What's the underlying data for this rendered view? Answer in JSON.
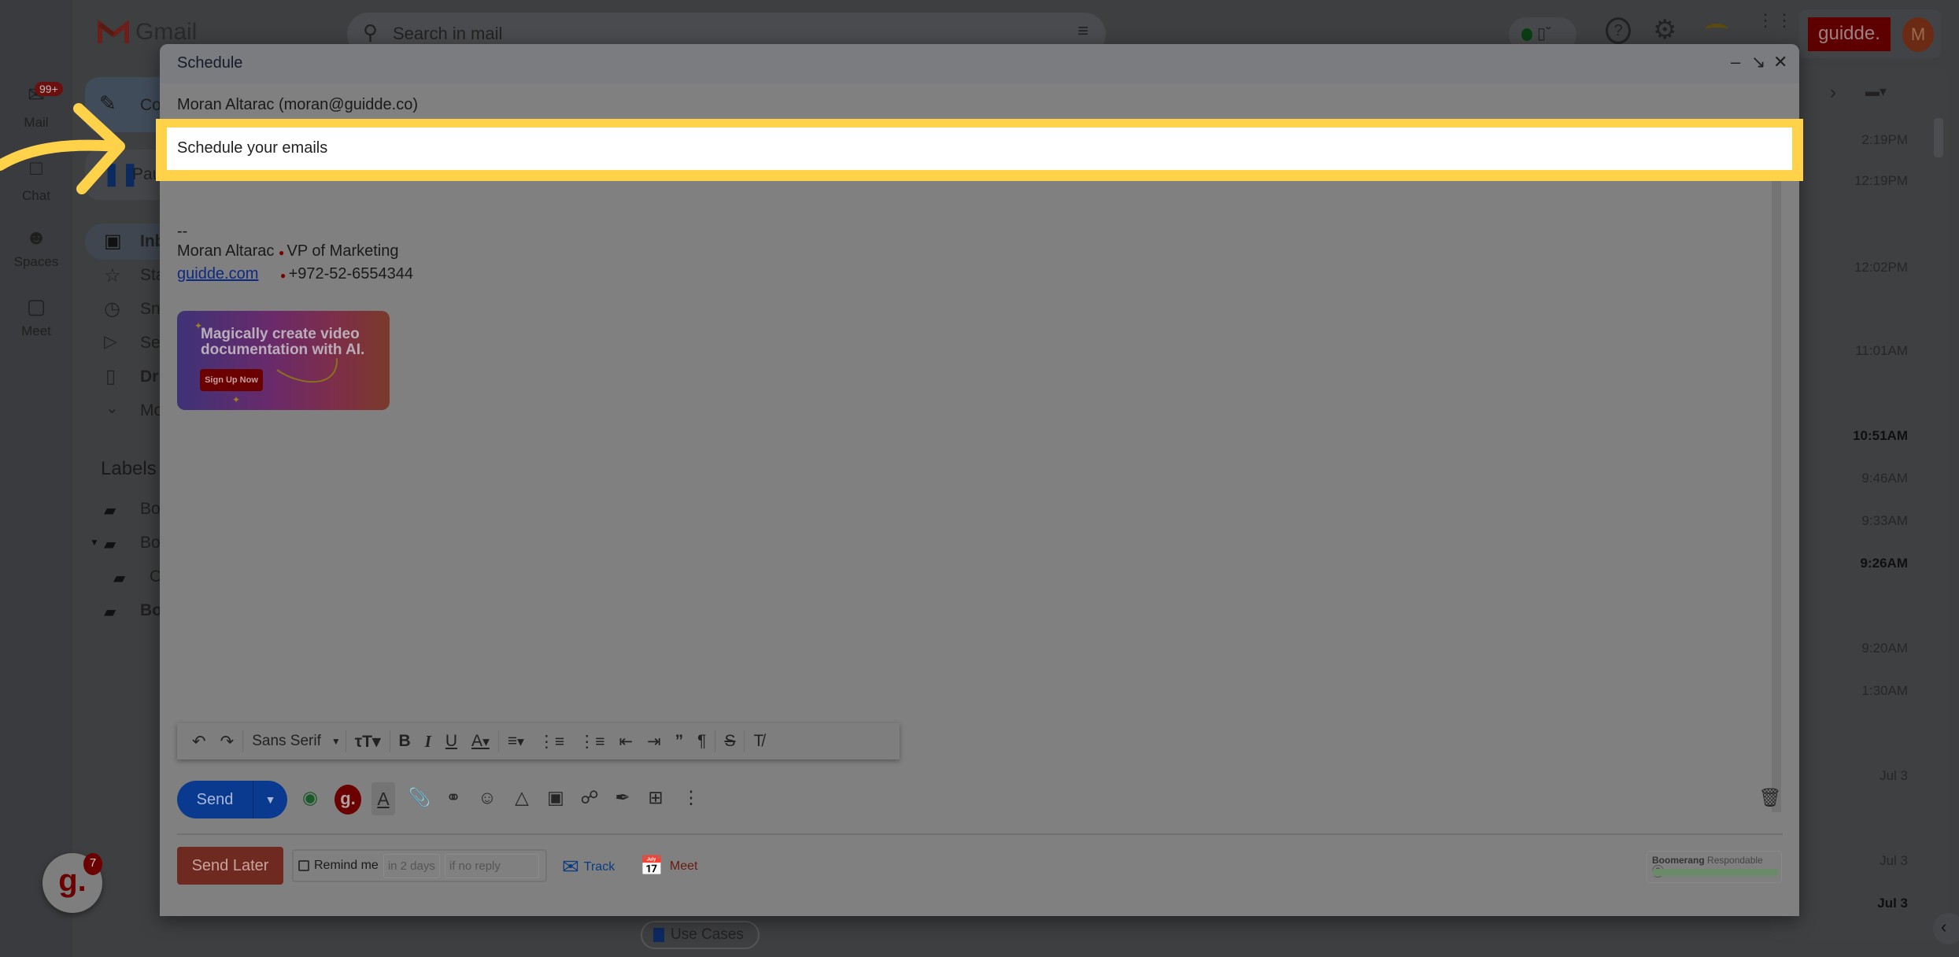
{
  "app": {
    "name": "Gmail",
    "search_placeholder": "Search in mail",
    "brand_logo": "guidde.",
    "avatar_initial": "M"
  },
  "rail": {
    "items": [
      {
        "label": "Mail",
        "icon": "mail-icon",
        "badge": "99+"
      },
      {
        "label": "Chat",
        "icon": "chat-icon"
      },
      {
        "label": "Spaces",
        "icon": "spaces-icon"
      },
      {
        "label": "Meet",
        "icon": "meet-icon"
      }
    ]
  },
  "sidebar": {
    "compose": "Co",
    "paused": "Pau",
    "items": [
      "Inb",
      "Sta",
      "Sn",
      "Se",
      "Dr",
      "Mo"
    ],
    "labels_heading": "Labels",
    "labels": [
      "Bo",
      "Bo",
      "C",
      "Bo"
    ]
  },
  "mail_list": {
    "times": [
      {
        "text": "2:19PM",
        "bold": false
      },
      {
        "text": "12:19PM",
        "bold": false
      },
      {
        "text": "12:02PM",
        "bold": false
      },
      {
        "text": "11:01AM",
        "bold": false
      },
      {
        "text": "10:51AM",
        "bold": true
      },
      {
        "text": "9:46AM",
        "bold": false
      },
      {
        "text": "9:33AM",
        "bold": false
      },
      {
        "text": "9:26AM",
        "bold": true
      },
      {
        "text": "9:20AM",
        "bold": false
      },
      {
        "text": "1:30AM",
        "bold": false
      },
      {
        "text": "Jul 3",
        "bold": false
      },
      {
        "text": "Jul 3",
        "bold": false
      },
      {
        "text": "Jul 3",
        "bold": true
      }
    ],
    "bottom_chip": "Use Cases"
  },
  "compose": {
    "title": "Schedule",
    "from": "Moran Altarac (moran@guidde.co)",
    "subject": "Schedule your emails",
    "signature": {
      "dashes": "--",
      "name": "Moran Altarac",
      "role": "VP of Marketing",
      "link": "guidde.com",
      "phone": "+972-52-6554344",
      "banner_text": "Magically create video documentation with AI.",
      "banner_button": "Sign Up Now"
    },
    "toolbar": {
      "font": "Sans Serif"
    },
    "send_label": "Send",
    "send_later_label": "Send Later",
    "remind_label": "Remind me",
    "remind_when": "in 2 days",
    "remind_condition": "if no reply",
    "track_label": "Track",
    "meet_label": "Meet",
    "boomerang_brand": "Boomerang",
    "boomerang_label": "Respondable",
    "boomerang_help": "?"
  },
  "floating_badge": {
    "count": "7",
    "logo": "g."
  },
  "colors": {
    "highlight": "#ffd24a",
    "send": "#0a3a8f",
    "send_later": "#6e2a20",
    "brand_red": "#5e0000"
  }
}
